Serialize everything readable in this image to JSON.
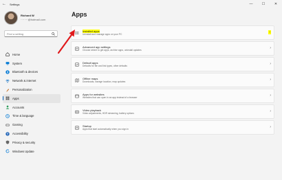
{
  "window": {
    "title": "Settings",
    "back_glyph": "←",
    "minimize_glyph": "—",
    "maximize_glyph": "☐",
    "close_glyph": "✕"
  },
  "profile": {
    "name": "Richard W",
    "email": "········@hotmail.com"
  },
  "search": {
    "placeholder": "Find a setting",
    "icon": "search-icon"
  },
  "nav": [
    {
      "label": "Home",
      "icon": "home-icon",
      "color": "#444444"
    },
    {
      "label": "System",
      "icon": "system-icon",
      "color": "#0078d4"
    },
    {
      "label": "Bluetooth & devices",
      "icon": "bluetooth-icon",
      "color": "#0078d4"
    },
    {
      "label": "Network & internet",
      "icon": "network-icon",
      "color": "#0067c0"
    },
    {
      "label": "Personalization",
      "icon": "personalization-icon",
      "color": "#c46a1c"
    },
    {
      "label": "Apps",
      "icon": "apps-icon",
      "color": "#555555",
      "active": true
    },
    {
      "label": "Accounts",
      "icon": "accounts-icon",
      "color": "#2e9e5b"
    },
    {
      "label": "Time & language",
      "icon": "time-icon",
      "color": "#0078d4"
    },
    {
      "label": "Gaming",
      "icon": "gaming-icon",
      "color": "#666666"
    },
    {
      "label": "Accessibility",
      "icon": "accessibility-icon",
      "color": "#1a5fb4"
    },
    {
      "label": "Privacy & security",
      "icon": "privacy-icon",
      "color": "#666666"
    },
    {
      "label": "Windows Update",
      "icon": "update-icon",
      "color": "#0078d4"
    }
  ],
  "page_title": "Apps",
  "cards": [
    {
      "title": "Installed apps",
      "subtitle": "Uninstall and manage apps on your PC",
      "icon": "installed-apps-icon",
      "highlighted": true
    },
    {
      "title": "Advanced app settings",
      "subtitle": "Choose where to get apps, archive apps, uninstall updates",
      "icon": "advanced-apps-icon"
    },
    {
      "title": "Default apps",
      "subtitle": "Defaults for file and link types, other defaults",
      "icon": "default-apps-icon"
    },
    {
      "title": "Offline maps",
      "subtitle": "Downloads, storage location, map updates",
      "icon": "offline-maps-icon"
    },
    {
      "title": "Apps for websites",
      "subtitle": "Websites that can open in an app instead of a browser",
      "icon": "apps-websites-icon"
    },
    {
      "title": "Video playback",
      "subtitle": "Video adjustments, HDR streaming, battery options",
      "icon": "video-playback-icon"
    },
    {
      "title": "Startup",
      "subtitle": "Apps that start automatically when you sign in",
      "icon": "startup-icon"
    }
  ],
  "colors": {
    "accent": "#005fb8",
    "highlight": "#ffff00",
    "arrow": "#e0191b"
  }
}
